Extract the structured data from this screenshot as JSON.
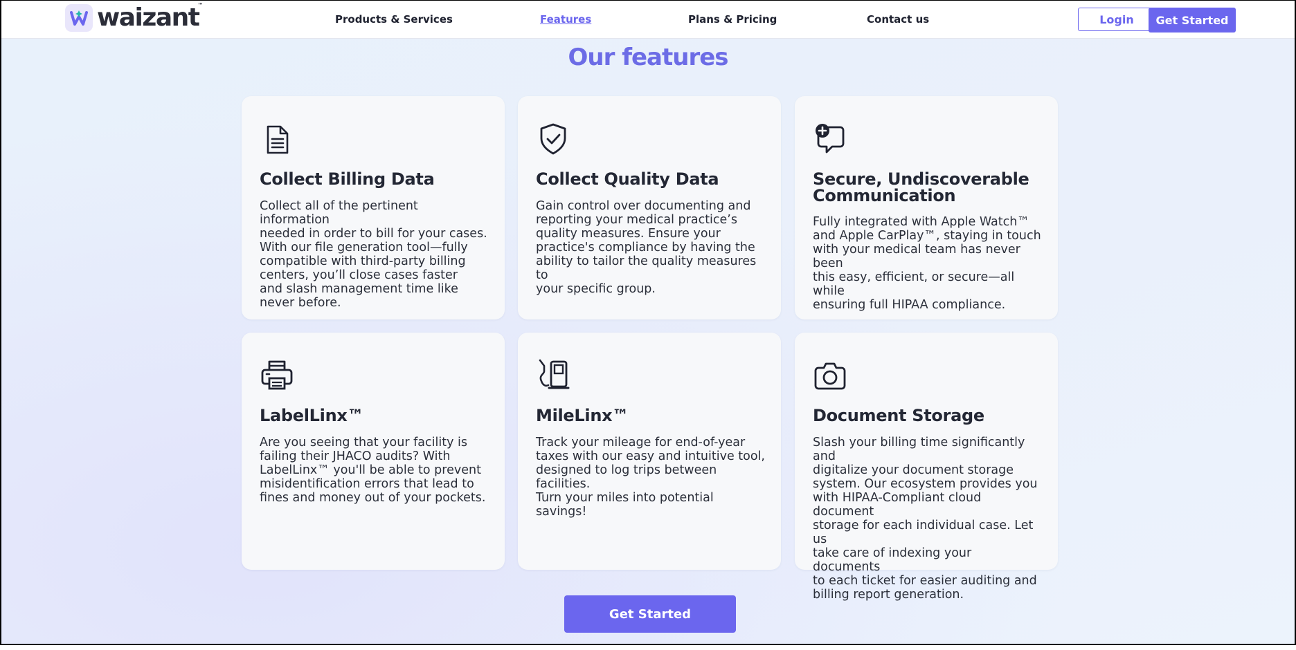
{
  "brand": {
    "name": "waizant",
    "trademark": "™",
    "accent": "#6b66ee",
    "logo_icon": "waizant-crown-icon"
  },
  "nav": {
    "links": [
      "Products & Services",
      "Features",
      "Plans & Pricing",
      "Contact us"
    ],
    "active": "Features",
    "login_label": "Login",
    "get_started_label": "Get Started"
  },
  "features": {
    "title": "Our features",
    "cards": [
      {
        "icon": "document-icon",
        "title": "Collect Billing Data",
        "lines": [
          "Collect all of the pertinent information",
          "needed in order to bill for your cases.",
          "With our file generation tool—fully",
          "compatible with third-party billing",
          "centers, you’ll close cases faster",
          "and slash management time like",
          "never before."
        ]
      },
      {
        "icon": "shield-check-icon",
        "title": "Collect Quality Data",
        "lines": [
          "Gain control over documenting and",
          "reporting your medical practice’s",
          "quality measures. Ensure your",
          "practice's compliance by having the",
          "ability to tailor the quality measures to",
          "your specific group."
        ]
      },
      {
        "icon": "chat-add-icon",
        "title": "Secure, Undiscoverable Communication",
        "lines": [
          "Fully integrated with Apple Watch™",
          "and Apple CarPlay™, staying in touch",
          "with your medical team has never been",
          "this easy, efficient, or secure—all while",
          "ensuring full HIPAA compliance."
        ]
      },
      {
        "icon": "printer-icon",
        "title": "LabelLinx™",
        "lines": [
          "Are you seeing that your facility is",
          "failing their JHACO audits? With",
          "LabelLinx™ you'll be able to prevent",
          "misidentification errors that lead to",
          "fines and money out of your pockets."
        ]
      },
      {
        "icon": "fuel-pump-icon",
        "title": "MileLinx™",
        "lines": [
          "Track your mileage for end-of-year",
          "taxes with our easy and intuitive tool,",
          "designed to log trips between facilities.",
          "Turn your miles into potential savings!"
        ]
      },
      {
        "icon": "camera-icon",
        "title": "Document Storage",
        "lines": [
          "Slash your billing time significantly and",
          "digitalize your document storage",
          "system. Our ecosystem provides you",
          "with HIPAA-Compliant cloud document",
          "storage for each individual case. Let us",
          "take care of indexing your documents",
          "to each ticket for easier auditing and",
          "billing report generation."
        ]
      }
    ]
  },
  "cta": {
    "label": "Get Started"
  }
}
